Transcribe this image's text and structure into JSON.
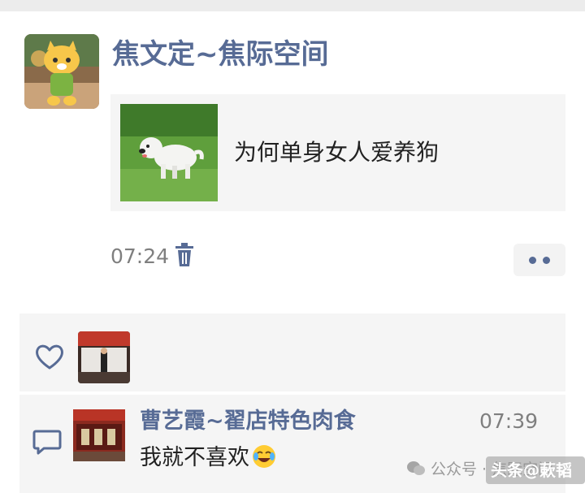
{
  "post": {
    "author": "焦文定~焦际空间",
    "link_title": "为何单身女人爱养狗",
    "time": "07:24",
    "delete_icon": "trash-icon",
    "more_icon": "more-dots-icon"
  },
  "likes": {
    "icon": "heart-icon"
  },
  "comment": {
    "icon": "comment-icon",
    "author": "曹艺霞~翟店特色肉食",
    "time": "07:39",
    "text": "我就不喜欢",
    "emoji": "laughing-tears-emoji"
  },
  "watermark": {
    "line1": "公众号 · 焦际空间",
    "line2": "头条@蔌韬"
  },
  "colors": {
    "name_link": "#576b95",
    "card_bg": "#f5f5f5",
    "meta_text": "#7f7f7f"
  }
}
